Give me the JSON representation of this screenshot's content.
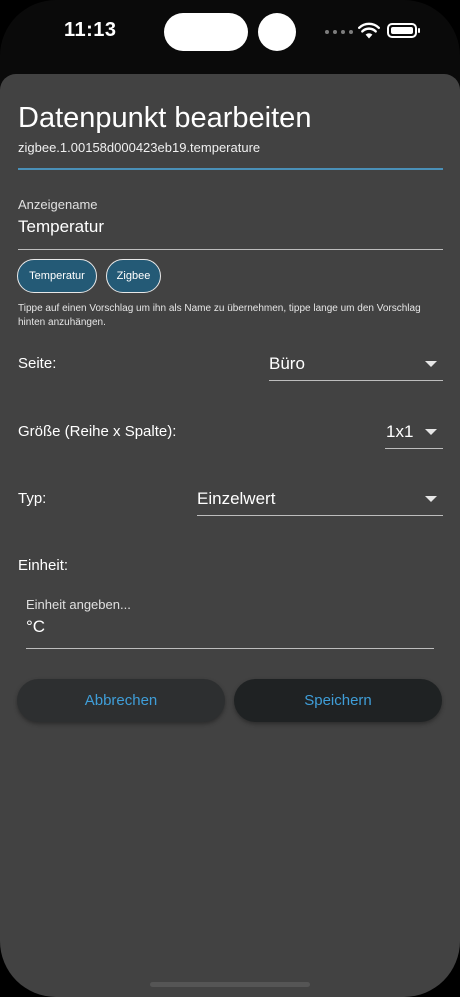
{
  "status": {
    "time": "11:13",
    "icons": [
      "signal-dots-icon",
      "wifi-icon",
      "battery-icon"
    ]
  },
  "dialog": {
    "title": "Datenpunkt bearbeiten",
    "subtitle": "zigbee.1.00158d000423eb19.temperature",
    "display_name": {
      "label": "Anzeigename",
      "value": "Temperatur"
    },
    "suggestions": [
      "Temperatur",
      "Zigbee"
    ],
    "hint": "Tippe auf einen Vorschlag um ihn als Name zu übernehmen, tippe lange um den Vorschlag hinten anzuhängen.",
    "page": {
      "label": "Seite:",
      "value": "Büro"
    },
    "size": {
      "label": "Größe (Reihe x Spalte):",
      "value": "1x1"
    },
    "type": {
      "label": "Typ:",
      "value": "Einzelwert"
    },
    "unit": {
      "label": "Einheit:",
      "input_label": "Einheit angeben...",
      "value": "°C"
    },
    "buttons": {
      "cancel": "Abbrechen",
      "save": "Speichern"
    }
  },
  "colors": {
    "accent": "#3f9ed8",
    "chip": "#245a76",
    "sheet": "#424242",
    "title_underline": "#4a90b8"
  }
}
